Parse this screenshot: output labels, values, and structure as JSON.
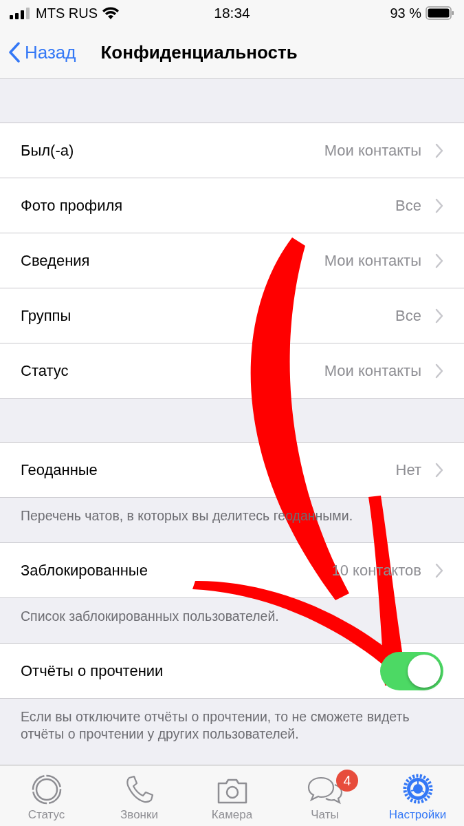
{
  "status_bar": {
    "carrier": "MTS RUS",
    "time": "18:34",
    "battery": "93 %"
  },
  "nav": {
    "back": "Назад",
    "title": "Конфиденциальность"
  },
  "sections": [
    {
      "rows": [
        {
          "kind": "link",
          "label": "Был(-а)",
          "value": "Мои контакты"
        },
        {
          "kind": "link",
          "label": "Фото профиля",
          "value": "Все"
        },
        {
          "kind": "link",
          "label": "Сведения",
          "value": "Мои контакты"
        },
        {
          "kind": "link",
          "label": "Группы",
          "value": "Все"
        },
        {
          "kind": "link",
          "label": "Статус",
          "value": "Мои контакты"
        }
      ]
    },
    {
      "rows": [
        {
          "kind": "link",
          "label": "Геоданные",
          "value": "Нет"
        }
      ],
      "footer": "Перечень чатов, в которых вы делитесь геоданными."
    },
    {
      "rows": [
        {
          "kind": "link",
          "label": "Заблокированные",
          "value": "10 контактов"
        }
      ],
      "footer": "Список заблокированных пользователей."
    },
    {
      "rows": [
        {
          "kind": "toggle",
          "label": "Отчёты о прочтении",
          "on": true
        }
      ],
      "footer": "Если вы отключите отчёты о прочтении, то не сможете видеть отчёты о прочтении у других пользователей."
    }
  ],
  "tabs": [
    {
      "kind": "status",
      "label": "Статус",
      "selected": false
    },
    {
      "kind": "calls",
      "label": "Звонки",
      "selected": false
    },
    {
      "kind": "camera",
      "label": "Камера",
      "selected": false
    },
    {
      "kind": "chats",
      "label": "Чаты",
      "selected": false,
      "badge": "4"
    },
    {
      "kind": "settings",
      "label": "Настройки",
      "selected": true
    }
  ]
}
